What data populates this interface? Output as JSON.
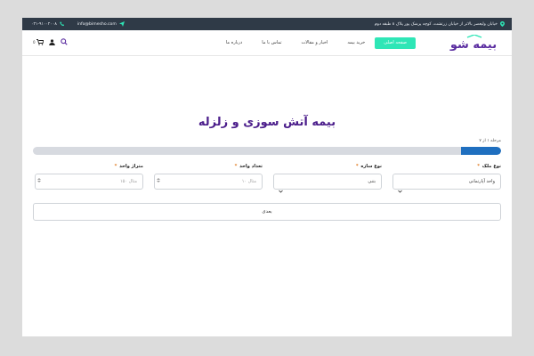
{
  "topbar": {
    "address": "خیابان ولیعصر بالاتر از خیابان زرتشت، کوچه پزشک پور پلاک ۸ طبقه دوم",
    "email": "info@bimesho.com",
    "phone": "۰۲۱-۹۱۰۰۲۰۰۸"
  },
  "header": {
    "logo_text": "بیمه شو",
    "nav": [
      {
        "label": "صفحه اصلی",
        "active": true
      },
      {
        "label": "خرید بیمه"
      },
      {
        "label": "اخبار و مقالات"
      },
      {
        "label": "تماس با ما"
      },
      {
        "label": "درباره ما"
      }
    ],
    "cart_count": "0"
  },
  "form": {
    "title": "بیمه آتش سوزی و زلزله",
    "step_text": "مرحله ۱ از ۷",
    "progress": 0.0857,
    "fields": [
      {
        "label": "نوع ملک",
        "required_mark": "*",
        "value": "واحد آپارتمانی",
        "type": "select"
      },
      {
        "label": "نوع سازه",
        "required_mark": "*",
        "value": "بتنی",
        "type": "select"
      },
      {
        "label": "تعداد واحد",
        "required_mark": "*",
        "placeholder": "مثال ۱۰",
        "type": "number"
      },
      {
        "label": "متراژ واحد",
        "required_mark": "*",
        "placeholder": "مثال ۱۵۰",
        "type": "number"
      }
    ],
    "next_label": "بعدی"
  },
  "colors": {
    "topbar_bg": "#2f3a47",
    "accent_green": "#2ee6b6",
    "title_purple": "#4b1d8b",
    "progress_blue": "#1f6fbf",
    "required_orange": "#e07a1f"
  }
}
